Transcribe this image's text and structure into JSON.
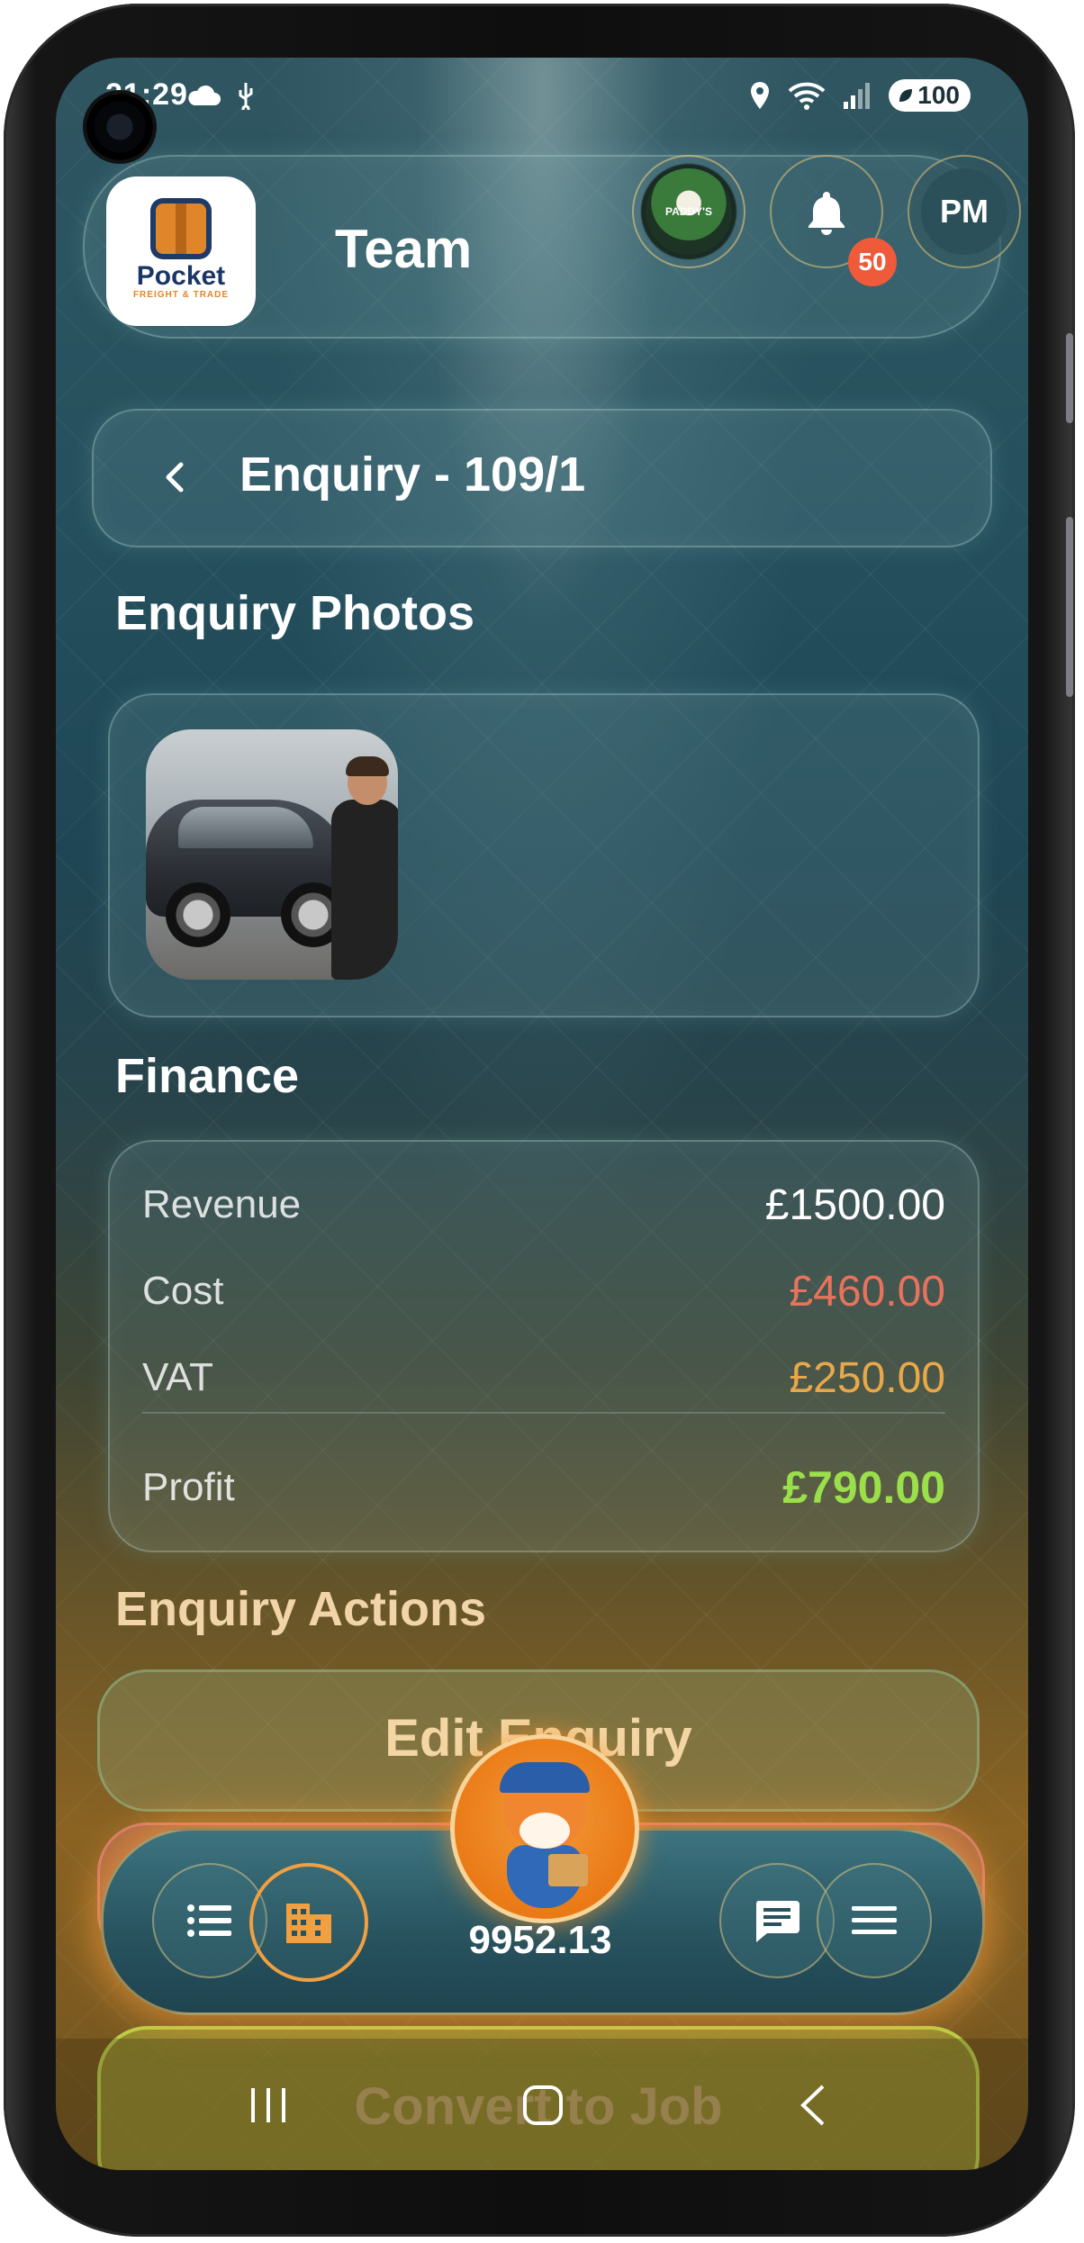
{
  "status_bar": {
    "time": "21:29",
    "battery": "100"
  },
  "header": {
    "app_name_line1": "Pocket",
    "app_name_line2": "FREIGHT & TRADE",
    "title": "Team",
    "company_logo_text": "PADDY'S",
    "notification_count": "50",
    "user_initials": "PM"
  },
  "page": {
    "title": "Enquiry - 109/1"
  },
  "photos": {
    "section_title": "Enquiry Photos"
  },
  "finance": {
    "section_title": "Finance",
    "rows": [
      {
        "label": "Revenue",
        "value": "£1500.00",
        "color": "#ffffff"
      },
      {
        "label": "Cost",
        "value": "£460.00",
        "color": "#e8735c"
      },
      {
        "label": "VAT",
        "value": "£250.00",
        "color": "#e8a84a"
      }
    ],
    "profit": {
      "label": "Profit",
      "value": "£790.00",
      "color": "#9be04a"
    }
  },
  "actions": {
    "section_title": "Enquiry Actions",
    "edit_label": "Edit Enquiry",
    "convert_label": "Convert to Job"
  },
  "bottom_nav": {
    "balance": "9952.13",
    "items": [
      "list-icon",
      "building-icon",
      "mascot",
      "chat-icon",
      "menu-icon"
    ]
  },
  "colors": {
    "accent": "#f0a040",
    "badge": "#ef5a3a"
  }
}
